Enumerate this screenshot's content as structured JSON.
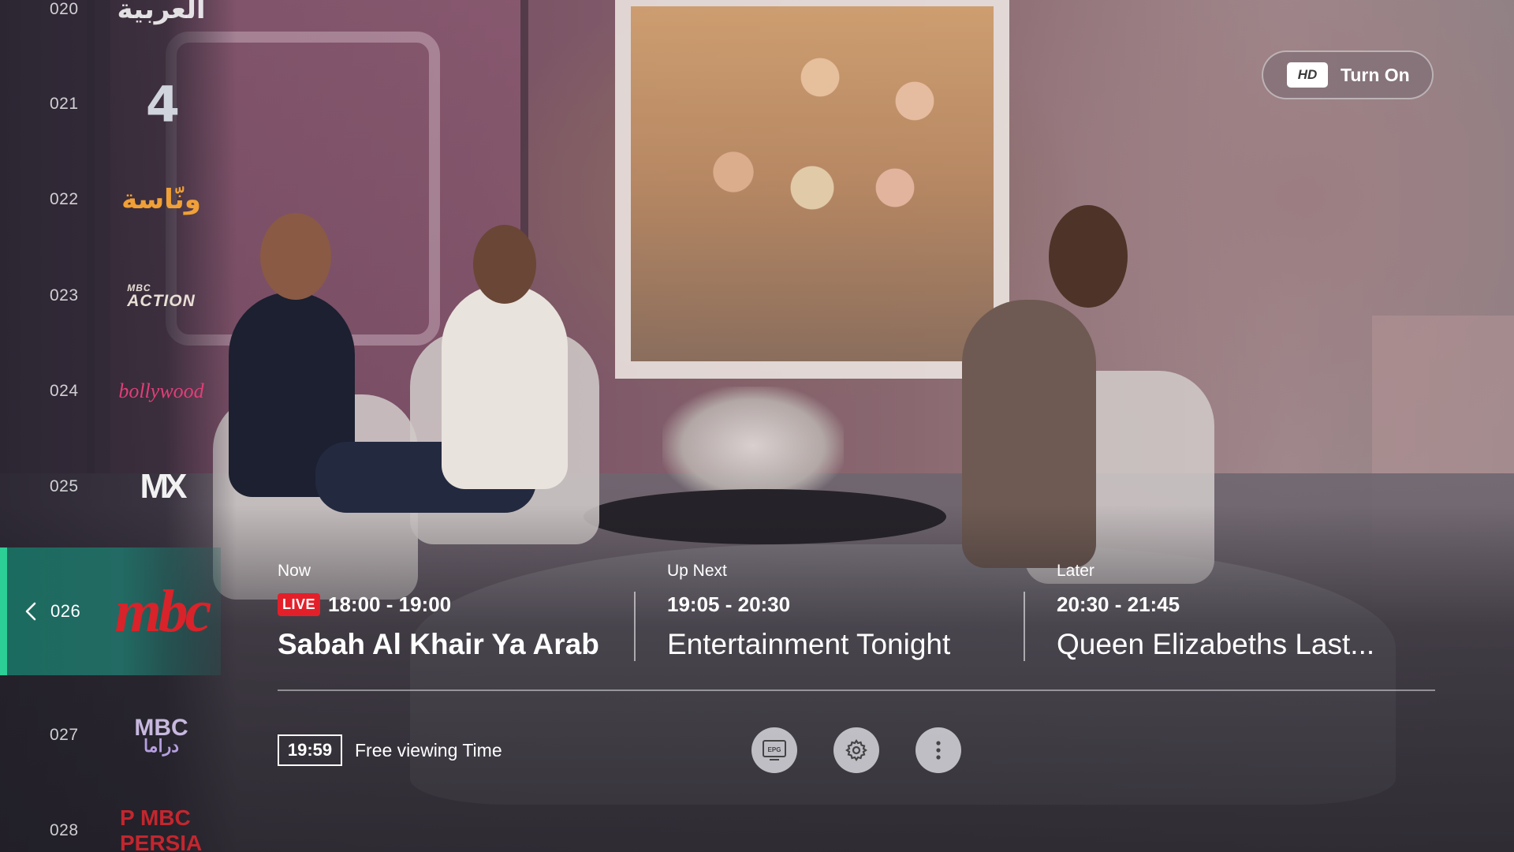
{
  "channels": [
    {
      "number": "020",
      "logo_text": "العربية",
      "logo_icon": "al-arabiya-logo"
    },
    {
      "number": "021",
      "logo_text": "4",
      "logo_icon": "mbc4-logo"
    },
    {
      "number": "022",
      "logo_text": "ونّاسة",
      "logo_icon": "wanasah-logo"
    },
    {
      "number": "023",
      "logo_text": "ACTION",
      "logo_sub": "MBC",
      "logo_icon": "mbc-action-logo"
    },
    {
      "number": "024",
      "logo_text": "bollywood",
      "logo_icon": "mbc-bollywood-logo"
    },
    {
      "number": "025",
      "logo_text": "MX",
      "logo_icon": "mbc-max-logo"
    },
    {
      "number": "026",
      "logo_text": "mbc",
      "logo_icon": "mbc1-logo"
    },
    {
      "number": "027",
      "logo_text": "MBC",
      "logo_sub": "دراما",
      "logo_icon": "mbc-drama-plus-logo"
    },
    {
      "number": "028",
      "logo_text": "P MBC PERSIA",
      "logo_icon": "mbc-persia-logo"
    }
  ],
  "active_channel_index": 6,
  "hd": {
    "badge": "HD",
    "label": "Turn On"
  },
  "programs": {
    "now": {
      "slot": "Now",
      "live_badge": "LIVE",
      "time": "18:00 - 19:00",
      "title": "Sabah Al Khair Ya Arab"
    },
    "next": {
      "slot": "Up Next",
      "time": "19:05 - 20:30",
      "title": "Entertainment Tonight"
    },
    "later": {
      "slot": "Later",
      "time": "20:30 - 21:45",
      "title": "Queen Elizabeths Last..."
    }
  },
  "footer": {
    "timer": "19:59",
    "timer_label": "Free viewing Time",
    "buttons": [
      {
        "name": "epg-button",
        "icon": "epg-icon",
        "text": "EPG"
      },
      {
        "name": "settings-button",
        "icon": "gear-icon"
      },
      {
        "name": "more-options-button",
        "icon": "more-vertical-icon"
      }
    ]
  },
  "colors": {
    "accent": "#2ccf95",
    "active_row": "#1b6b5f",
    "live": "#e3202a",
    "mbc_red": "#d8232a"
  }
}
